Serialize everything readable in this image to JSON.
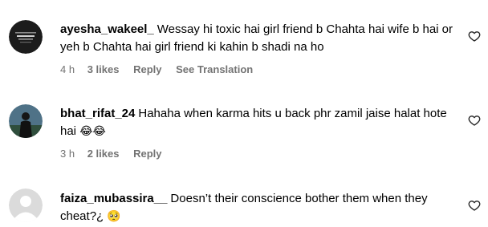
{
  "comments": [
    {
      "username": "ayesha_wakeel_",
      "text": "Wessay hi toxic hai girl friend b Chahta hai wife b hai or yeh b Chahta hai girl friend ki kahin b shadi na ho",
      "emoji": "",
      "time": "4 h",
      "likes": "3 likes",
      "reply": "Reply",
      "translation": "See Translation",
      "avatar_text": "IF YOU CAN DREAM IT"
    },
    {
      "username": "bhat_rifat_24",
      "text": "Hahaha when karma hits u back phr zamil jaise halat hote hai",
      "emoji": "😂😂",
      "time": "3 h",
      "likes": "2 likes",
      "reply": "Reply"
    },
    {
      "username": "faiza_mubassira__",
      "text": "Doesn’t their conscience bother them when they cheat?¿",
      "emoji": "🥺"
    }
  ],
  "icons": {
    "like": "heart-outline-icon"
  },
  "colors": {
    "meta_text": "#737373",
    "default_avatar_bg": "#dbdbdb"
  }
}
